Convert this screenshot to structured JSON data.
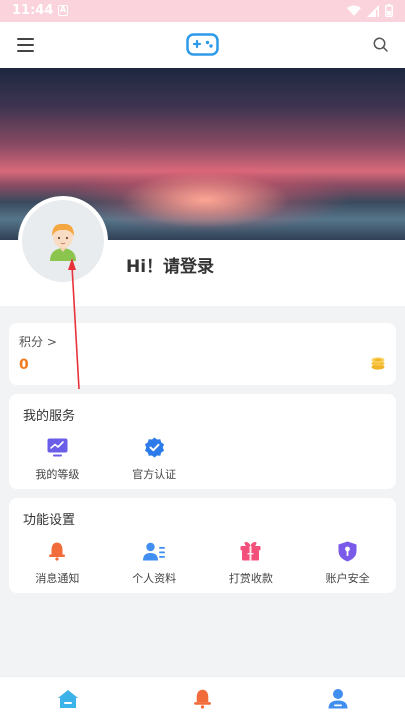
{
  "status_bar": {
    "time": "11:44",
    "notification_letter": "A"
  },
  "profile": {
    "greeting": "Hi！请登录"
  },
  "points": {
    "label": "积分 >",
    "value": "0"
  },
  "services": {
    "title": "我的服务",
    "items": [
      {
        "label": "我的等级",
        "icon": "level-chart-icon"
      },
      {
        "label": "官方认证",
        "icon": "verified-badge-icon"
      }
    ]
  },
  "settings": {
    "title": "功能设置",
    "items": [
      {
        "label": "消息通知",
        "icon": "bell-icon"
      },
      {
        "label": "个人资料",
        "icon": "profile-card-icon"
      },
      {
        "label": "打赏收款",
        "icon": "gift-icon"
      },
      {
        "label": "账户安全",
        "icon": "shield-icon"
      }
    ]
  },
  "bottom_nav": [
    {
      "name": "home",
      "icon": "home-icon"
    },
    {
      "name": "notifications",
      "icon": "bell-icon"
    },
    {
      "name": "me",
      "icon": "user-icon"
    }
  ],
  "colors": {
    "accent_orange": "#f07a1f",
    "brand_blue": "#2d9bea",
    "status_bar": "#fbd3dc"
  }
}
